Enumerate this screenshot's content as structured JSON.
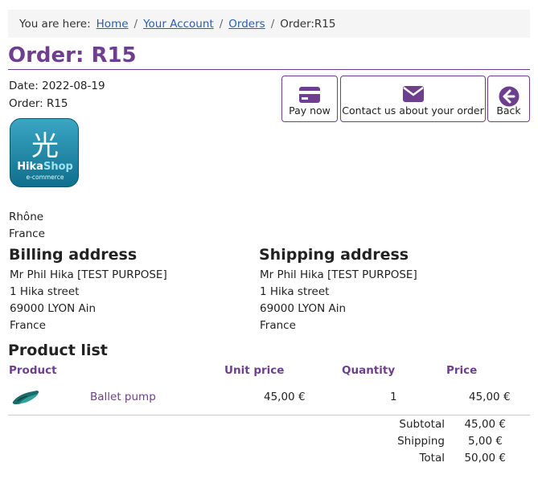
{
  "breadcrumb": {
    "prefix": "You are here:",
    "items": [
      "Home",
      "Your Account",
      "Orders"
    ],
    "current": "Order:R15"
  },
  "page_title": "Order: R15",
  "order_meta": {
    "date": "Date: 2022-08-19",
    "order": "Order: R15"
  },
  "actions": {
    "pay_now": "Pay now",
    "contact": "Contact us about your order",
    "back": "Back"
  },
  "logo": {
    "glyph": "光",
    "word_a": "Hika",
    "word_b": "Shop",
    "sub": "e-commerce"
  },
  "store_address": [
    "Rhône",
    "France"
  ],
  "billing": {
    "title": "Billing address",
    "lines": [
      "Mr Phil Hika [TEST PURPOSE]",
      "1 Hika street",
      "69000 LYON Ain",
      "France"
    ]
  },
  "shipping": {
    "title": "Shipping address",
    "lines": [
      "Mr Phil Hika [TEST PURPOSE]",
      "1 Hika street",
      "69000 LYON Ain",
      "France"
    ]
  },
  "products": {
    "title": "Product list",
    "headers": {
      "product": "Product",
      "unit_price": "Unit price",
      "quantity": "Quantity",
      "price": "Price"
    },
    "rows": [
      {
        "name": "Ballet pump",
        "unit_price": "45,00 €",
        "quantity": "1",
        "price": "45,00 €"
      }
    ]
  },
  "totals": {
    "subtotal_label": "Subtotal",
    "subtotal": "45,00 €",
    "shipping_label": "Shipping",
    "shipping": "5,00 €",
    "total_label": "Total",
    "total": "50,00 €"
  },
  "colors": {
    "accent": "#6e3f8f",
    "link": "#2a5db0"
  }
}
